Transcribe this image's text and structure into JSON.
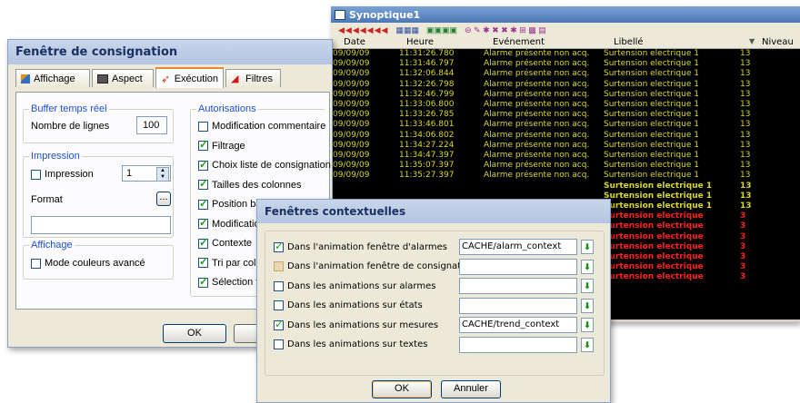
{
  "synoptique": {
    "title": "Synoptique1",
    "columns": [
      "Date",
      "Heure",
      "Evénement",
      "Libellé",
      "Niveau"
    ],
    "rows": [
      [
        "09/09/09",
        "11:31:26.780",
        "Alarme présente non acq.",
        "Surtension electrique 1",
        "13"
      ],
      [
        "09/09/09",
        "11:31:46.797",
        "Alarme présente non acq.",
        "Surtension electrique 1",
        "13"
      ],
      [
        "09/09/09",
        "11:32:06.844",
        "Alarme présente non acq.",
        "Surtension electrique 1",
        "13"
      ],
      [
        "09/09/09",
        "11:32:26.798",
        "Alarme présente non acq.",
        "Surtension electrique 1",
        "13"
      ],
      [
        "09/09/09",
        "11:32:46.799",
        "Alarme présente non acq.",
        "Surtension electrique 1",
        "13"
      ],
      [
        "09/09/09",
        "11:33:06.800",
        "Alarme présente non acq.",
        "Surtension electrique 1",
        "13"
      ],
      [
        "09/09/09",
        "11:33:26.785",
        "Alarme présente non acq.",
        "Surtension electrique 1",
        "13"
      ],
      [
        "09/09/09",
        "11:33:46.801",
        "Alarme présente non acq.",
        "Surtension electrique 1",
        "13"
      ],
      [
        "09/09/09",
        "11:34:06.802",
        "Alarme présente non acq.",
        "Surtension electrique 1",
        "13"
      ],
      [
        "09/09/09",
        "11:34:27.224",
        "Alarme présente non acq.",
        "Surtension electrique 1",
        "13"
      ],
      [
        "09/09/09",
        "11:34:47.397",
        "Alarme présente non acq.",
        "Surtension electrique 1",
        "13"
      ],
      [
        "09/09/09",
        "11:35:07.397",
        "Alarme présente non acq.",
        "Surtension electrique 1",
        "13"
      ],
      [
        "09/09/09",
        "11:35:27.397",
        "Alarme présente non acq.",
        "Surtension electrique 1",
        "13"
      ]
    ],
    "tail_rows": [
      {
        "label": "Surtension electrique 1",
        "level": "13",
        "color": "#d8d824"
      },
      {
        "label": "Surtension electrique 1",
        "level": "13",
        "color": "#d8d824"
      },
      {
        "label": "Surtension electrique 1",
        "level": "13",
        "color": "#d8d824"
      },
      {
        "label": "Surtension electrique",
        "level": "3",
        "color": "#ff2020"
      },
      {
        "label": "Surtension electrique",
        "level": "3",
        "color": "#ff2020"
      },
      {
        "label": "Surtension electrique",
        "level": "3",
        "color": "#ff2020"
      },
      {
        "label": "Surtension electrique",
        "level": "3",
        "color": "#ff2020"
      },
      {
        "label": "Surtension electrique",
        "level": "3",
        "color": "#ff2020"
      },
      {
        "label": "Surtension electrique",
        "level": "3",
        "color": "#ff2020"
      },
      {
        "label": "Surtension electrique",
        "level": "3",
        "color": "#ff2020"
      }
    ],
    "colors": {
      "active": "#d8d824",
      "background": "#000000"
    }
  },
  "consignation": {
    "title": "Fenêtre de consignation",
    "tabs": [
      "Affichage",
      "Aspect",
      "Exécution",
      "Filtres"
    ],
    "buffer": {
      "legend": "Buffer temps réel",
      "label": "Nombre de lignes",
      "value": "100"
    },
    "impression": {
      "legend": "Impression",
      "check_label": "Impression",
      "spin_value": "1",
      "format_label": "Format",
      "browse": "..."
    },
    "affichage": {
      "legend": "Affichage",
      "check_label": "Mode couleurs avancé"
    },
    "autorisations": {
      "legend": "Autorisations",
      "items": [
        "Modification commentaire",
        "Filtrage",
        "Choix liste de consignation",
        "Tailles des colonnes",
        "Position barre d'outils",
        "Modification",
        "Contexte",
        "Tri par colonnes",
        "Sélection tr"
      ]
    },
    "ok": "OK",
    "cancel": "An"
  },
  "contextuelles": {
    "title": "Fenêtres contextuelles",
    "rows": [
      {
        "label": "Dans l'animation fenêtre d'alarmes",
        "value": "CACHE/alarm_context",
        "checked": true
      },
      {
        "label": "Dans l'animation fenêtre de consignations",
        "value": "",
        "checked": false,
        "disabled": true
      },
      {
        "label": "Dans les animations sur alarmes",
        "value": "",
        "checked": false
      },
      {
        "label": "Dans les animations sur états",
        "value": "",
        "checked": false
      },
      {
        "label": "Dans les animations sur mesures",
        "value": "CACHE/trend_context",
        "checked": true
      },
      {
        "label": "Dans les animations sur textes",
        "value": "",
        "checked": false
      }
    ],
    "ok": "OK",
    "cancel": "Annuler"
  }
}
